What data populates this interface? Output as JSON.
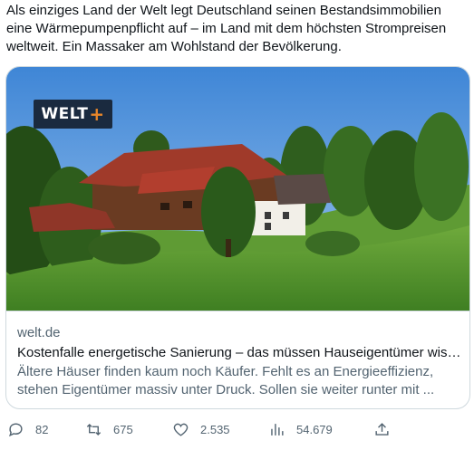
{
  "tweet": {
    "text": "Als einziges Land der Welt legt Deutschland seinen Bestandsimmobilien eine Wärmepumpenpflicht auf – im Land mit dem höchsten Strompreisen weltweit. Ein Massaker am Wohlstand der Bevölkerung."
  },
  "card": {
    "logo_text": "WELT",
    "logo_plus": "+",
    "domain": "welt.de",
    "title": "Kostenfalle energetische Sanierung – das müssen Hauseigentümer wissen",
    "description": "Ältere Häuser finden kaum noch Käufer. Fehlt es an Energieeffizienz, stehen Eigentümer massiv unter Druck. Sollen sie weiter runter mit ..."
  },
  "actions": {
    "replies": "82",
    "retweets": "675",
    "likes": "2.535",
    "views": "54.679"
  },
  "icons": {
    "reply": "reply-icon",
    "retweet": "retweet-icon",
    "like": "heart-icon",
    "views": "views-icon",
    "share": "share-icon"
  },
  "colors": {
    "text": "#0f1419",
    "secondary": "#536471",
    "border": "#cfd9de",
    "logo_bg": "#1a2a3f",
    "logo_plus": "#e8862a"
  }
}
